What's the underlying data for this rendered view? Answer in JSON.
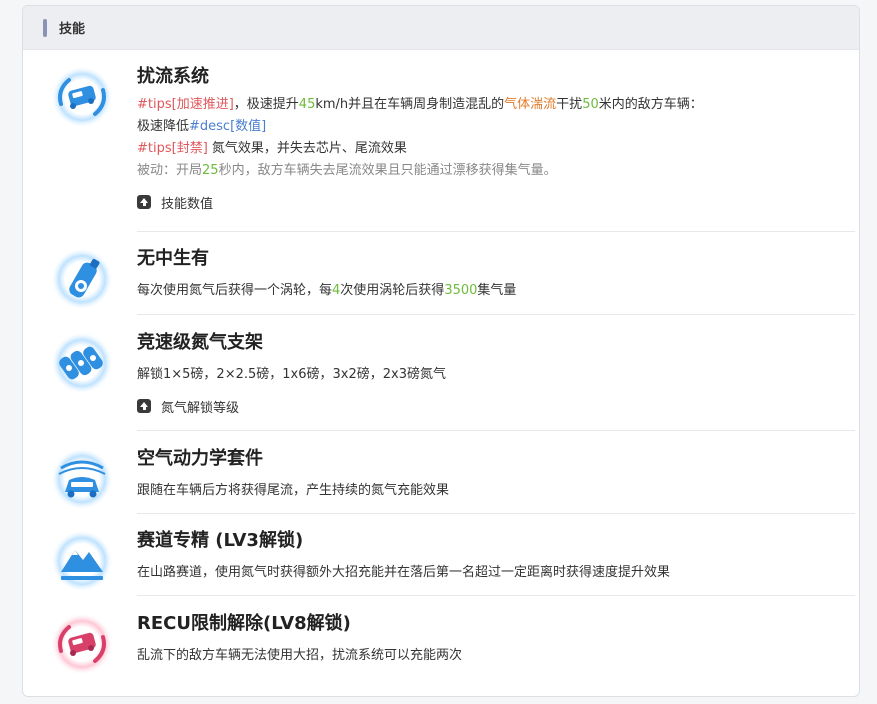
{
  "header": {
    "title": "技能"
  },
  "skills": [
    {
      "name": "扰流系统",
      "line1": {
        "tip": "#tips[加速推进]",
        "a": "，极速提升",
        "n1": "45",
        "b": "km/h并且在车辆周身制造混乱的",
        "hl": "气体湍流",
        "c": "干扰",
        "n2": "50",
        "d": "米内的敌方车辆："
      },
      "line2": {
        "a": "极速降低",
        "desc": "#desc[数值]"
      },
      "line3": {
        "tip": "#tips[封禁]",
        "a": " 氮气效果，并失去芯片、尾流效果"
      },
      "line4": {
        "a": "被动：开局",
        "n": "25",
        "b": "秒内，敌方车辆失去尾流效果且只能通过漂移获得集气量。"
      },
      "expand_label": "技能数值"
    },
    {
      "name": "无中生有",
      "line1": {
        "a": "每次使用氮气后获得一个涡轮，每",
        "n1": "4",
        "b": "次使用涡轮后获得",
        "n2": "3500",
        "c": "集气量"
      }
    },
    {
      "name": "竞速级氮气支架",
      "line1": "解锁1×5磅，2×2.5磅，1x6磅，3x2磅，2x3磅氮气",
      "expand_label": "氮气解锁等级"
    },
    {
      "name": "空气动力学套件",
      "line1": "跟随在车辆后方将获得尾流，产生持续的氮气充能效果"
    },
    {
      "name": "赛道专精 (LV3解锁)",
      "line1": "在山路赛道，使用氮气时获得额外大招充能并在落后第一名超过一定距离时获得速度提升效果"
    },
    {
      "name": "RECU限制解除(LV8解锁)",
      "line1": "乱流下的敌方车辆无法使用大招，扰流系统可以充能两次"
    }
  ],
  "colors": {
    "icon_blue": "#2f8fe0",
    "icon_pink": "#d8406a",
    "tip_red": "#e0575b",
    "number_green": "#6cbb3c",
    "highlight_orange": "#e07c2a",
    "desc_blue": "#4a7fd0"
  },
  "icons": [
    "car-turbulence-icon",
    "nitro-bottle-icon",
    "nitro-rack-icon",
    "aero-kit-icon",
    "mountain-track-icon",
    "recu-car-icon"
  ]
}
